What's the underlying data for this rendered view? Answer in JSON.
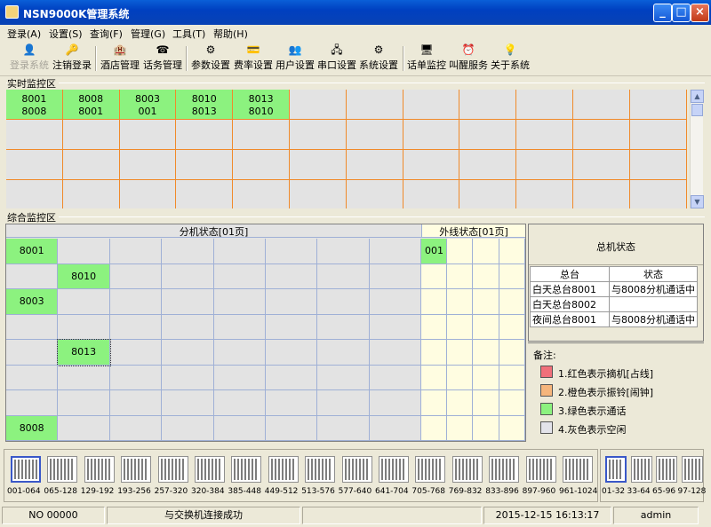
{
  "window": {
    "title": "NSN9000K管理系统"
  },
  "menu": [
    "登录(A)",
    "设置(S)",
    "查询(F)",
    "管理(G)",
    "工具(T)",
    "帮助(H)"
  ],
  "toolbar": [
    {
      "label": "登录系统",
      "icon": "login-icon",
      "disabled": true
    },
    {
      "label": "注销登录",
      "icon": "logout-icon",
      "disabled": false
    },
    {
      "label": "酒店管理",
      "icon": "hotel-icon",
      "disabled": false
    },
    {
      "label": "话务管理",
      "icon": "phone-icon",
      "disabled": false
    },
    {
      "label": "参数设置",
      "icon": "gear-icon",
      "disabled": false
    },
    {
      "label": "费率设置",
      "icon": "rate-icon",
      "disabled": false
    },
    {
      "label": "用户设置",
      "icon": "users-icon",
      "disabled": false
    },
    {
      "label": "串口设置",
      "icon": "serial-port-icon",
      "disabled": false
    },
    {
      "label": "系统设置",
      "icon": "settings-icon",
      "disabled": false
    },
    {
      "label": "话单监控",
      "icon": "monitor-icon",
      "disabled": false
    },
    {
      "label": "叫醒服务",
      "icon": "alarm-clock-icon",
      "disabled": false
    },
    {
      "label": "关于系统",
      "icon": "about-icon",
      "disabled": false
    }
  ],
  "realtime": {
    "label": "实时监控区",
    "active": [
      [
        "8001",
        "8008"
      ],
      [
        "8008",
        "8001"
      ],
      [
        "8003",
        "001"
      ],
      [
        "8010",
        "8013"
      ],
      [
        "8013",
        "8010"
      ]
    ]
  },
  "overview": {
    "label": "综合监控区",
    "ext_header": "分机状态[01页]",
    "trunk_header": "外线状态[01页]",
    "ext_cells": [
      {
        "row": 0,
        "col": 0,
        "text": "8001"
      },
      {
        "row": 1,
        "col": 1,
        "text": "8010"
      },
      {
        "row": 2,
        "col": 0,
        "text": "8003"
      },
      {
        "row": 4,
        "col": 1,
        "text": "8013"
      },
      {
        "row": 7,
        "col": 0,
        "text": "8008"
      }
    ],
    "trunk_cells": [
      {
        "row": 0,
        "col": 0,
        "text": "001"
      }
    ]
  },
  "host_status": {
    "title": "总机状态",
    "columns": [
      "总台",
      "状态"
    ],
    "rows": [
      [
        "白天总台8001",
        "与8008分机通话中"
      ],
      [
        "白天总台8002",
        ""
      ],
      [
        "夜间总台8001",
        "与8008分机通话中"
      ]
    ]
  },
  "notes": {
    "title": "备注:",
    "items": [
      {
        "text": "1.红色表示摘机[占线]",
        "color": "#f0707a"
      },
      {
        "text": "2.橙色表示振铃[闹钟]",
        "color": "#f5b57c"
      },
      {
        "text": "3.绿色表示通话",
        "color": "#8cf27f"
      },
      {
        "text": "4.灰色表示空闲",
        "color": "#e3e3ea"
      }
    ]
  },
  "pages": [
    "001-064",
    "065-128",
    "129-192",
    "193-256",
    "257-320",
    "320-384",
    "385-448",
    "449-512",
    "513-576",
    "577-640",
    "641-704",
    "705-768",
    "769-832",
    "833-896",
    "897-960",
    "961-1024"
  ],
  "trunk_pages": [
    "01-32",
    "33-64",
    "65-96",
    "97-128"
  ],
  "status_bar": {
    "no": "NO 00000",
    "message": "与交换机连接成功",
    "datetime": "2015-12-15 16:13:17",
    "user": "admin"
  }
}
